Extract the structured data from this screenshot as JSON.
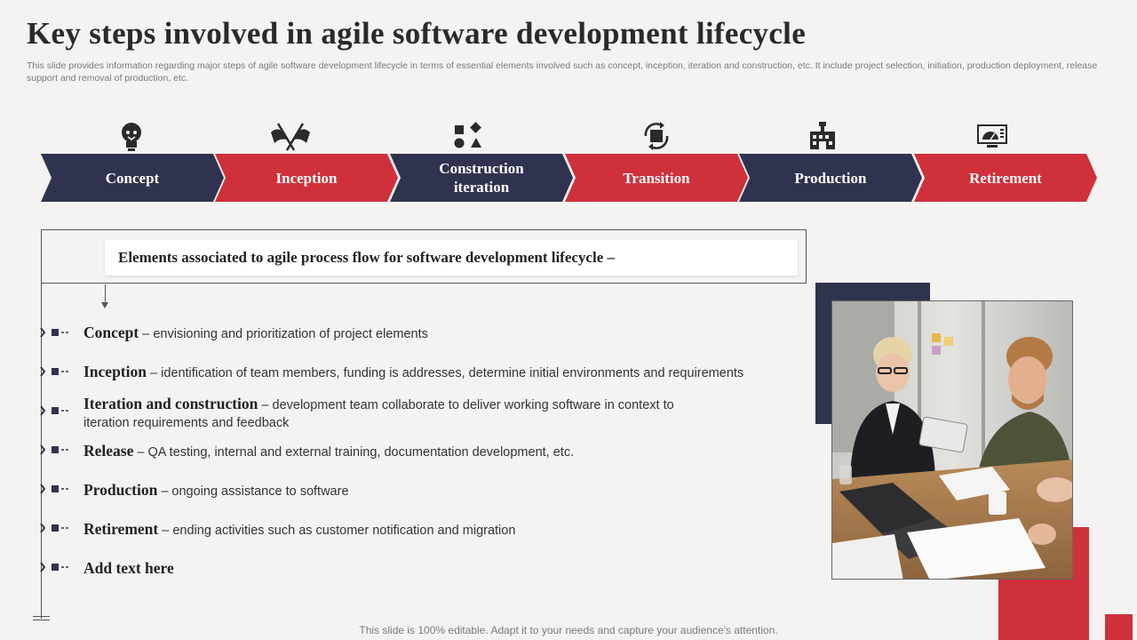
{
  "title": "Key steps involved in agile software development lifecycle",
  "subtitle": "This slide provides information regarding major steps of agile software development lifecycle in terms of essential elements involved such as concept, inception, iteration and construction, etc. It include project selection, initiation, production deployment, release support and removal of production, etc.",
  "colors": {
    "navy": "#30334f",
    "red": "#d0303a",
    "background": "#f4f3f1",
    "icon": "#2a2a2a"
  },
  "steps": [
    {
      "label": "Concept",
      "icon": "lightbulb-icon",
      "color": "navy"
    },
    {
      "label": "Inception",
      "icon": "crossed-flags-icon",
      "color": "red"
    },
    {
      "label": "Construction iteration",
      "icon": "shapes-icon",
      "color": "navy"
    },
    {
      "label": "Transition",
      "icon": "cycle-box-icon",
      "color": "red"
    },
    {
      "label": "Production",
      "icon": "factory-icon",
      "color": "navy"
    },
    {
      "label": "Retirement",
      "icon": "monitor-gauge-icon",
      "color": "red"
    }
  ],
  "elements_heading": "Elements associated to agile process flow for software development lifecycle –",
  "elements": [
    {
      "term": "Concept",
      "sep": " – ",
      "desc": "envisioning and prioritization of project elements"
    },
    {
      "term": "Inception",
      "sep": " – ",
      "desc": "identification of team members, funding is addresses, determine initial environments and requirements"
    },
    {
      "term": "Iteration and construction",
      "sep": " – ",
      "desc": "development team collaborate to deliver working software in context to iteration requirements and feedback"
    },
    {
      "term": "Release",
      "sep": " – ",
      "desc": "QA testing, internal and external training, documentation development, etc."
    },
    {
      "term": "Production",
      "sep": " – ",
      "desc": "ongoing assistance to software"
    },
    {
      "term": "Retirement",
      "sep": " – ",
      "desc": "ending activities such as customer notification and migration"
    },
    {
      "term": "Add text here",
      "sep": "",
      "desc": ""
    }
  ],
  "footer": "This slide is 100% editable. Adapt it to your needs and capture your audience's attention."
}
